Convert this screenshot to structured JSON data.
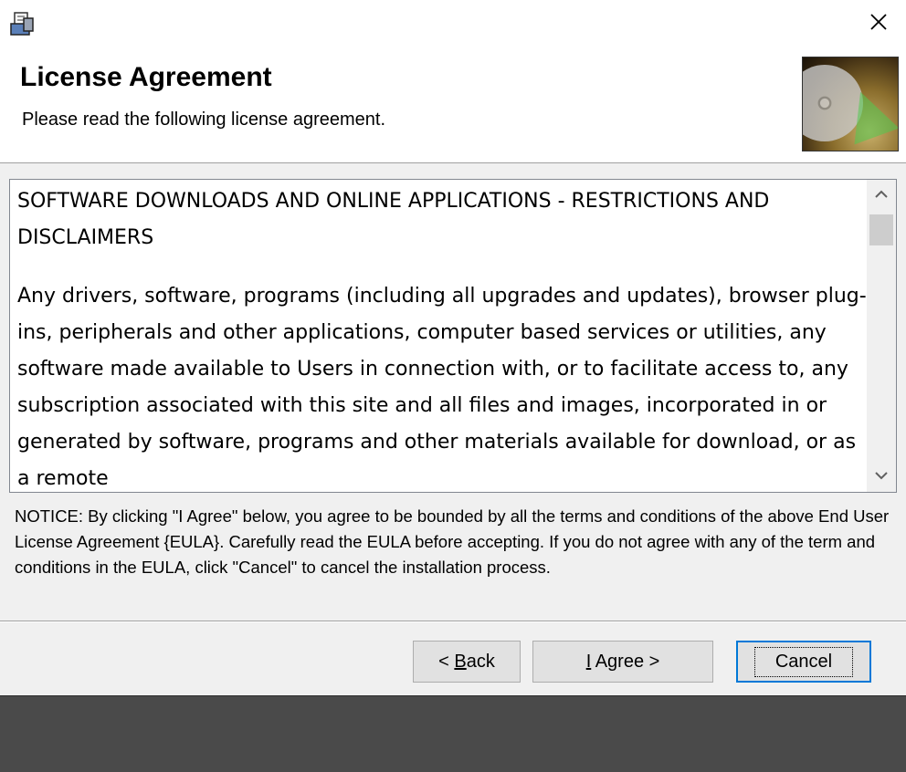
{
  "window": {
    "icon": "installer-icon",
    "close_icon": "close-icon"
  },
  "header": {
    "title": "License Agreement",
    "subtitle": "Please read the following license agreement.",
    "image": "disc-graphic"
  },
  "license": {
    "paragraphs": [
      "SOFTWARE DOWNLOADS AND ONLINE APPLICATIONS - RESTRICTIONS AND DISCLAIMERS",
      "Any drivers, software, programs (including all upgrades and updates), browser plug-ins, peripherals and other applications, computer based services or utilities, any software made available to Users in connection with, or to facilitate access to, any subscription associated with this site and all files and images, incorporated in or generated by software, programs and other materials available for download, or as a remote"
    ]
  },
  "notice": "NOTICE: By clicking \"I Agree\" below, you agree to be bounded by all the terms and conditions of the above End User License Agreement {EULA}. Carefully read the EULA before accepting. If you do not agree with any of the term and conditions in the EULA, click \"Cancel\" to cancel the installation process.",
  "buttons": {
    "back_prefix": "< ",
    "back_mnemonic": "B",
    "back_rest": "ack",
    "agree_mnemonic": "I",
    "agree_rest": " Agree >",
    "cancel": "Cancel"
  }
}
